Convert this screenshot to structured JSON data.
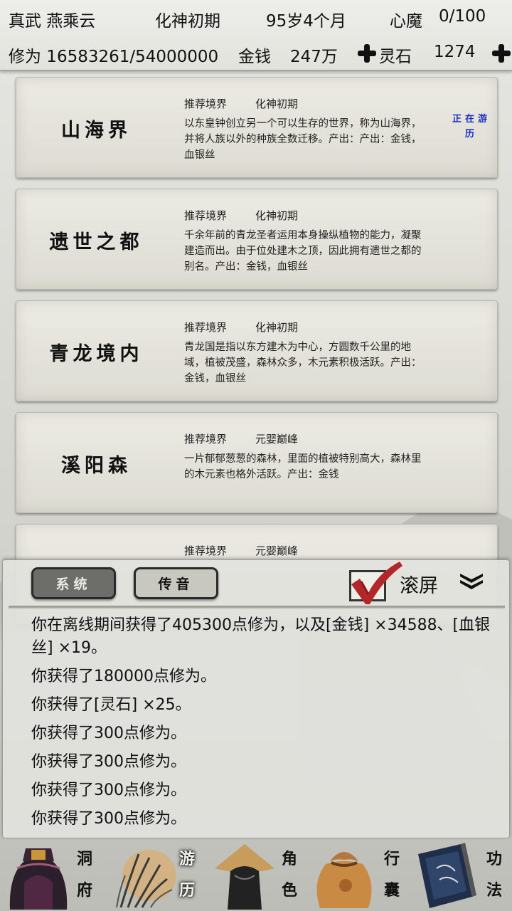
{
  "header": {
    "char_name": "真武 燕乘云",
    "realm": "化神初期",
    "age": "95岁4个月",
    "heart_demon_label": "心魔",
    "heart_demon_value": "0/100",
    "cultivation": "修为 16583261/54000000",
    "money_label": "金钱",
    "money_value": "247万",
    "spirit_stone_label": "灵石",
    "spirit_stone_value": "1274"
  },
  "locations": [
    {
      "name": "山海界",
      "realm_label": "推荐境界",
      "realm": "化神初期",
      "desc": "以东皇钟创立另一个可以生存的世界，称为山海界，并将人族以外的种族全数迁移。产出：产出：金钱，血银丝",
      "status": "正在游历"
    },
    {
      "name": "遗世之都",
      "realm_label": "推荐境界",
      "realm": "化神初期",
      "desc": "千余年前的青龙圣者运用本身操纵植物的能力，凝聚建造而出。由于位处建木之顶，因此拥有遗世之都的别名。产出：金钱，血银丝",
      "status": ""
    },
    {
      "name": "青龙境内",
      "realm_label": "推荐境界",
      "realm": "化神初期",
      "desc": "青龙国是指以东方建木为中心，方圆数千公里的地域，植被茂盛，森林众多，木元素积极活跃。产出：金钱，血银丝",
      "status": ""
    },
    {
      "name": "溪阳森",
      "realm_label": "推荐境界",
      "realm": "元婴巅峰",
      "desc": "一片郁郁葱葱的森林，里面的植被特别高大，森林里的木元素也格外活跃。产出：金钱",
      "status": ""
    },
    {
      "name": "",
      "realm_label": "推荐境界",
      "realm": "元婴巅峰",
      "desc": "",
      "status": ""
    }
  ],
  "chat": {
    "tab_system": "系统",
    "tab_voice": "传音",
    "scroll_label": "滚屏",
    "scroll_checked": true,
    "lines": [
      "你在离线期间获得了405300点修为，以及[金钱] ×34588、[血银丝] ×19。",
      "你获得了180000点修为。",
      "你获得了[灵石] ×25。",
      "你获得了300点修为。",
      "你获得了300点修为。",
      "你获得了300点修为。",
      "你获得了300点修为。"
    ]
  },
  "nav": {
    "items": [
      {
        "label_1": "洞",
        "label_2": "府",
        "icon": "cave-dwelling-icon"
      },
      {
        "label_1": "游",
        "label_2": "历",
        "icon": "travel-icon",
        "active": true
      },
      {
        "label_1": "角",
        "label_2": "色",
        "icon": "character-icon"
      },
      {
        "label_1": "行",
        "label_2": "囊",
        "icon": "bag-icon"
      },
      {
        "label_1": "功",
        "label_2": "法",
        "icon": "skill-book-icon"
      }
    ]
  },
  "colors": {
    "status_blue": "#1c2cc8",
    "check_red": "#b3262a",
    "tab_system_bg": "#6d6d6a"
  }
}
